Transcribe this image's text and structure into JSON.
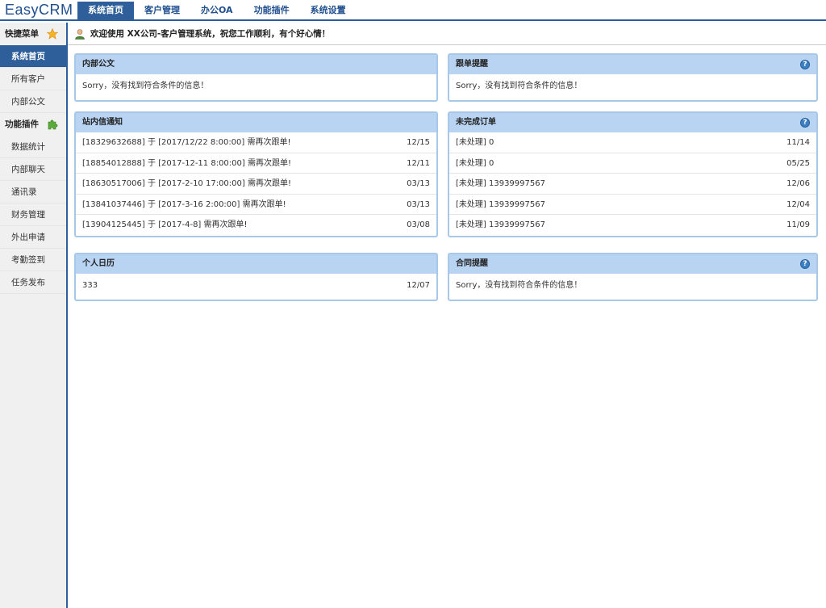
{
  "app": {
    "logo": "EasyCRM"
  },
  "nav": {
    "tabs": [
      {
        "label": "系统首页"
      },
      {
        "label": "客户管理"
      },
      {
        "label": "办公OA"
      },
      {
        "label": "功能插件"
      },
      {
        "label": "系统设置"
      }
    ]
  },
  "sidebar": {
    "quick_title": "快捷菜单",
    "quick_items": [
      {
        "label": "系统首页"
      },
      {
        "label": "所有客户"
      },
      {
        "label": "内部公文"
      }
    ],
    "plugin_title": "功能插件",
    "plugin_items": [
      {
        "label": "数据统计"
      },
      {
        "label": "内部聊天"
      },
      {
        "label": "通讯录"
      },
      {
        "label": "财务管理"
      },
      {
        "label": "外出申请"
      },
      {
        "label": "考勤签到"
      },
      {
        "label": "任务发布"
      }
    ]
  },
  "welcome": "欢迎使用 XX公司-客户管理系统，祝您工作顺利，有个好心情！",
  "panels": {
    "internal_docs": {
      "title": "内部公文",
      "empty": "Sorry，没有找到符合条件的信息！"
    },
    "followup": {
      "title": "跟单提醒",
      "empty": "Sorry，没有找到符合条件的信息！"
    },
    "messages": {
      "title": "站内信通知",
      "rows": [
        {
          "text": "[18329632688] 于 [2017/12/22 8:00:00] 需再次跟单!",
          "date": "12/15"
        },
        {
          "text": "[18854012888] 于 [2017-12-11 8:00:00] 需再次跟单!",
          "date": "12/11"
        },
        {
          "text": "[18630517006] 于 [2017-2-10 17:00:00] 需再次跟单!",
          "date": "03/13"
        },
        {
          "text": "[13841037446] 于 [2017-3-16 2:00:00] 需再次跟单!",
          "date": "03/13"
        },
        {
          "text": "[13904125445] 于 [2017-4-8] 需再次跟单!",
          "date": "03/08"
        }
      ]
    },
    "orders": {
      "title": "未完成订单",
      "rows": [
        {
          "text": "[未处理] 0",
          "date": "11/14"
        },
        {
          "text": "[未处理] 0",
          "date": "05/25"
        },
        {
          "text": "[未处理] 13939997567",
          "date": "12/06"
        },
        {
          "text": "[未处理] 13939997567",
          "date": "12/04"
        },
        {
          "text": "[未处理] 13939997567",
          "date": "11/09"
        }
      ]
    },
    "calendar": {
      "title": "个人日历",
      "rows": [
        {
          "text": "333",
          "date": "12/07"
        }
      ]
    },
    "contract": {
      "title": "合同提醒",
      "empty": "Sorry，没有找到符合条件的信息！"
    }
  },
  "colors": {
    "primary": "#2f5f9a",
    "panel_header": "#b8d4f2",
    "panel_border": "#a8c8ea",
    "sidebar_bg": "#f0f0f0"
  }
}
